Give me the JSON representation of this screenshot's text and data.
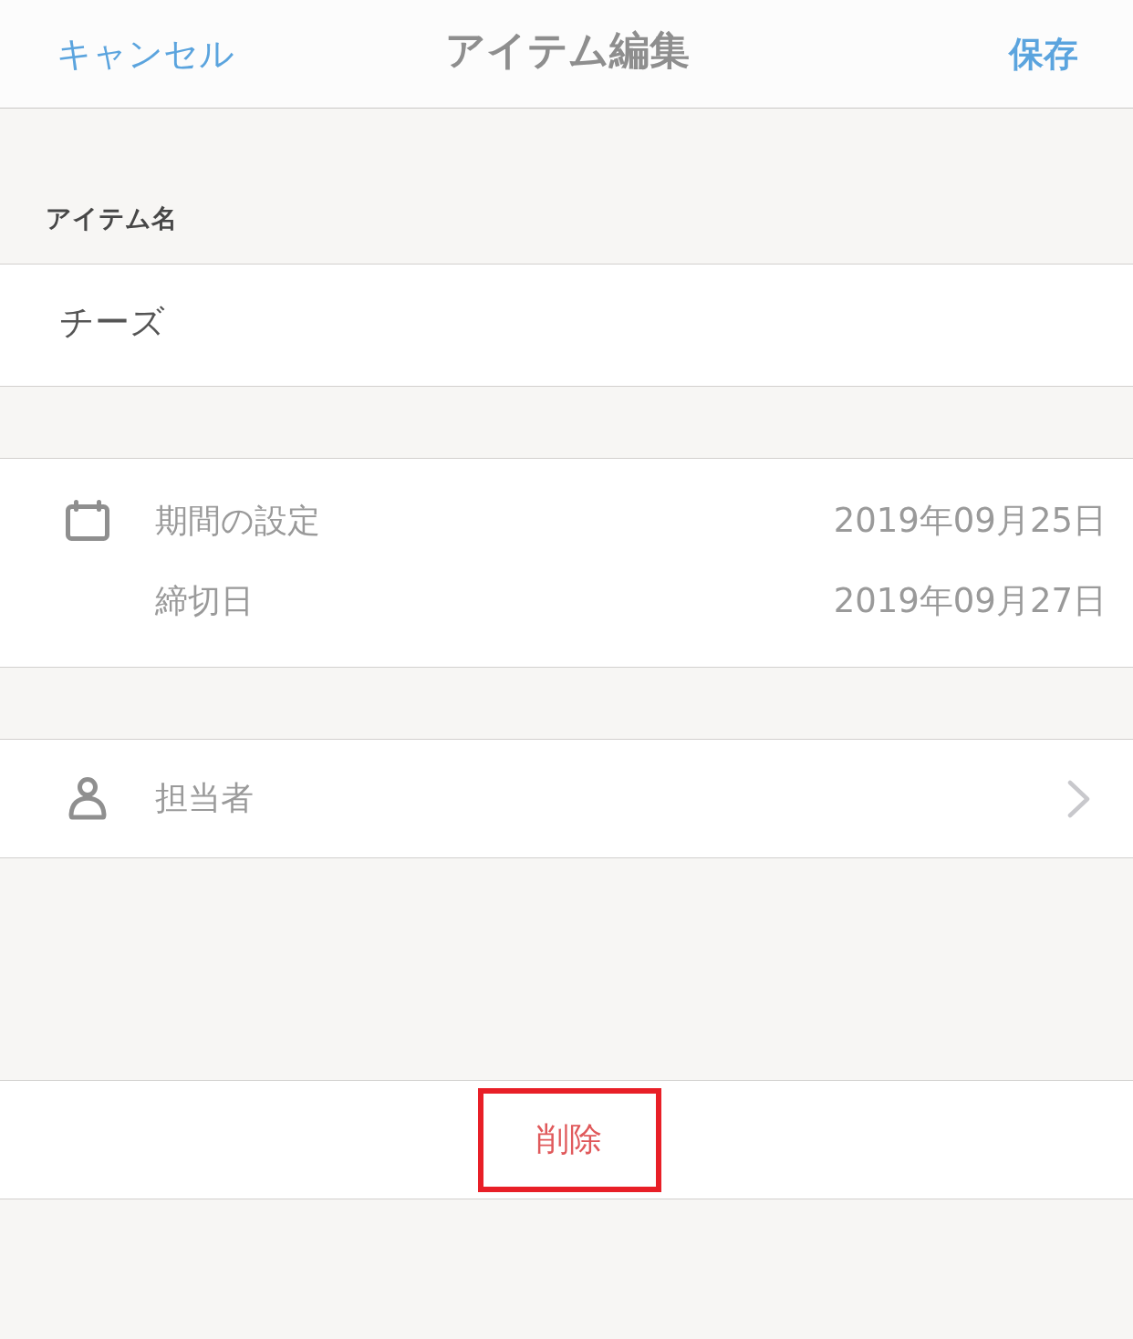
{
  "header": {
    "cancel": "キャンセル",
    "title": "アイテム編集",
    "save": "保存"
  },
  "item_name": {
    "label": "アイテム名",
    "value": "チーズ"
  },
  "dates": [
    {
      "label": "期間の設定",
      "value": "2019年09月25日"
    },
    {
      "label": "締切日",
      "value": "2019年09月27日"
    }
  ],
  "assignee": {
    "label": "担当者"
  },
  "delete": {
    "label": "削除",
    "highlighted": true
  }
}
